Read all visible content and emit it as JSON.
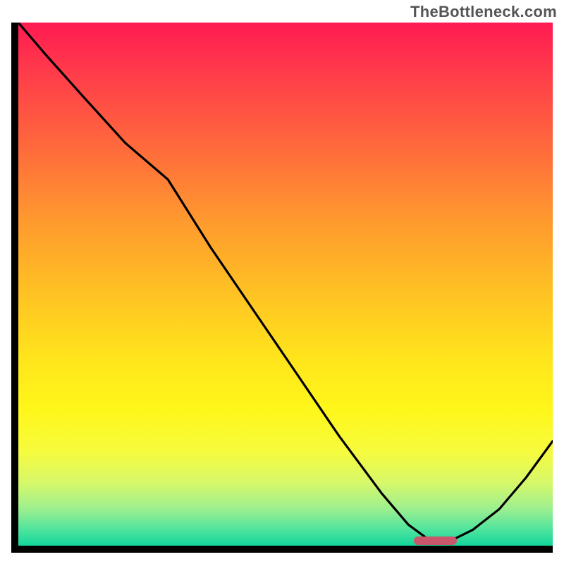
{
  "watermark": "TheBottleneck.com",
  "chart_data": {
    "type": "line",
    "title": "",
    "xlabel": "",
    "ylabel": "",
    "xlim": [
      0,
      100
    ],
    "ylim": [
      0,
      100
    ],
    "grid": false,
    "legend": false,
    "description": "Single black curve over a vertical color gradient (red → yellow → green). Curve starts near top-left, decreases, flattens near the bottom around x≈77, then rises toward the right edge. A short horizontal marker sits at the curve's flat minimum.",
    "gradient_stops": [
      {
        "pct": 0,
        "color": "#ff1a52"
      },
      {
        "pct": 10,
        "color": "#ff3d4a"
      },
      {
        "pct": 24,
        "color": "#ff6a3c"
      },
      {
        "pct": 38,
        "color": "#ff9a2e"
      },
      {
        "pct": 52,
        "color": "#ffc323"
      },
      {
        "pct": 64,
        "color": "#ffe41c"
      },
      {
        "pct": 74,
        "color": "#fff71a"
      },
      {
        "pct": 82,
        "color": "#f6fb3e"
      },
      {
        "pct": 88,
        "color": "#d7f86a"
      },
      {
        "pct": 93,
        "color": "#9cef8f"
      },
      {
        "pct": 97,
        "color": "#4de39e"
      },
      {
        "pct": 100,
        "color": "#13d79b"
      }
    ],
    "series": [
      {
        "name": "curve",
        "x": [
          0,
          5,
          12,
          20,
          28,
          36,
          44,
          52,
          60,
          68,
          73,
          77,
          81,
          85,
          90,
          95,
          100
        ],
        "y": [
          100,
          94,
          86,
          77,
          70,
          57,
          45,
          33,
          21,
          10,
          4,
          1,
          1,
          3,
          7,
          13,
          20
        ]
      }
    ],
    "marker": {
      "x_start": 74,
      "x_end": 82,
      "y": 1
    },
    "colors": {
      "axis": "#000000",
      "curve": "#000000",
      "marker": "#c9566a"
    }
  }
}
